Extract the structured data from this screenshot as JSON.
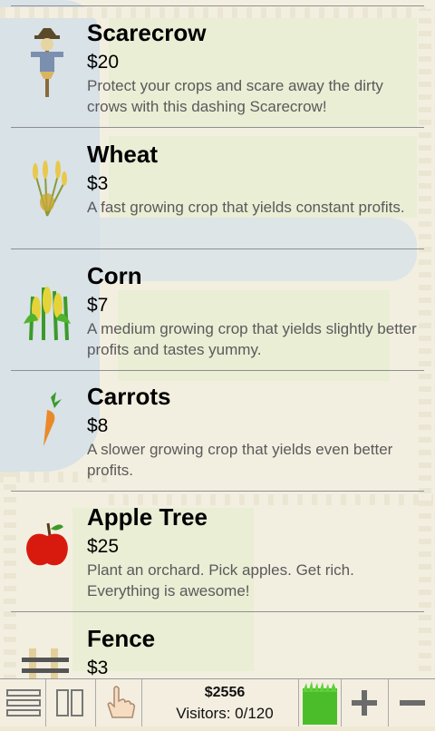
{
  "shop_items": [
    {
      "name": "Scarecrow",
      "price": "$20",
      "desc": "Protect your crops and scare away the dirty crows with this dashing Scarecrow!",
      "icon": "scarecrow-icon"
    },
    {
      "name": "Wheat",
      "price": "$3",
      "desc": "A fast growing crop that yields constant profits.",
      "icon": "wheat-icon"
    },
    {
      "name": "Corn",
      "price": "$7",
      "desc": "A medium growing crop that yields slightly better profits and tastes yummy.",
      "icon": "corn-icon"
    },
    {
      "name": "Carrots",
      "price": "$8",
      "desc": "A slower growing crop that yields even better profits.",
      "icon": "carrot-icon"
    },
    {
      "name": "Apple Tree",
      "price": "$25",
      "desc": "Plant an orchard. Pick apples. Get rich. Everything is awesome!",
      "icon": "apple-icon"
    },
    {
      "name": "Fence",
      "price": "$3",
      "desc": "",
      "icon": "fence-icon"
    }
  ],
  "status": {
    "money": "$2556",
    "visitors": "Visitors: 0/120"
  },
  "toolbar": {
    "icons": [
      "menu-icon",
      "pause-icon",
      "hand-pointer-icon",
      "grass-tile-icon",
      "zoom-in-icon",
      "zoom-out-icon"
    ]
  },
  "colors": {
    "water": "#a9c9e8",
    "grass": "#d6e6b8",
    "divider": "#8f8f8f"
  }
}
